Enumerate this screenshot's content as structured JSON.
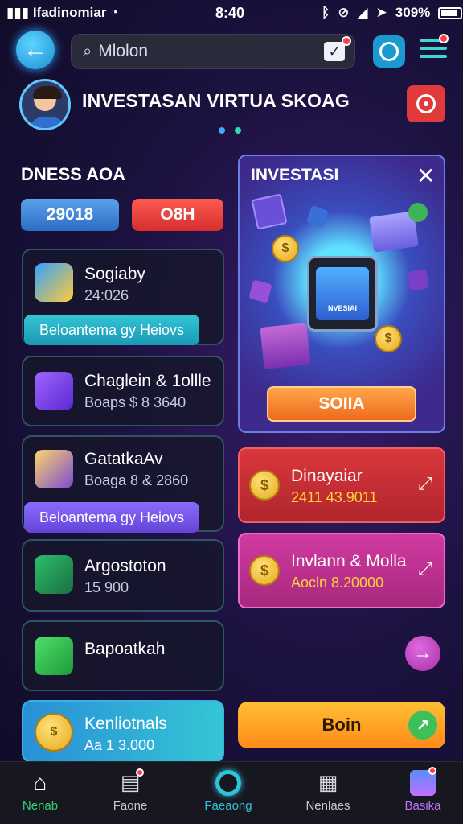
{
  "status_bar": {
    "carrier": "Ifadinomiar",
    "time": "8:40",
    "battery": "309%"
  },
  "header": {
    "search": {
      "value": "Mlolon",
      "placeholder": "Mlolon"
    }
  },
  "profile": {
    "title": "INVESTASAN VIRTUA SKOAG"
  },
  "left": {
    "section_label": "DNESS AOA",
    "pill_blue": "29018",
    "pill_red": "O8H",
    "cards": [
      {
        "name": "Sogiaby",
        "value": "24:026",
        "banner": "Beloantema gy Heiovs"
      },
      {
        "name": "Chaglein & 1ollle",
        "value": "Boaps $ 8 3640"
      },
      {
        "name": "GatatkaAv",
        "value": "Boaga 8 & 2860",
        "banner": "Beloantema gy Heiovs"
      },
      {
        "name": "Argostoton",
        "value": "15 900"
      },
      {
        "name": "Bapoatkah",
        "value": ""
      },
      {
        "name": "Kenliotnals",
        "value": "Aa 1 3.000"
      }
    ]
  },
  "promo": {
    "title": "INVESTASI",
    "tablet_text": "NVESIAI",
    "button": "SOIIA"
  },
  "right_cards": [
    {
      "name": "Dinayaiar",
      "value": "2411 43.9011",
      "color": "#c92f35"
    },
    {
      "name": "Invlann & Molla",
      "value": "Aocln 8.20000",
      "color": "#c4328f"
    }
  ],
  "go_button": "Boin",
  "nav": [
    {
      "label": "Nenab",
      "icon": "home-icon",
      "active": true,
      "color": "#33d07a"
    },
    {
      "label": "Faone",
      "icon": "portfolio-icon",
      "active": false,
      "color": "#c8c8d4"
    },
    {
      "label": "Faeaong",
      "icon": "target-icon",
      "active": false,
      "color": "#2fc3d9"
    },
    {
      "label": "Nenlaes",
      "icon": "news-icon",
      "active": false,
      "color": "#c8c8d4"
    },
    {
      "label": "Basika",
      "icon": "profile-icon",
      "active": false,
      "color": "#c070ff"
    }
  ]
}
